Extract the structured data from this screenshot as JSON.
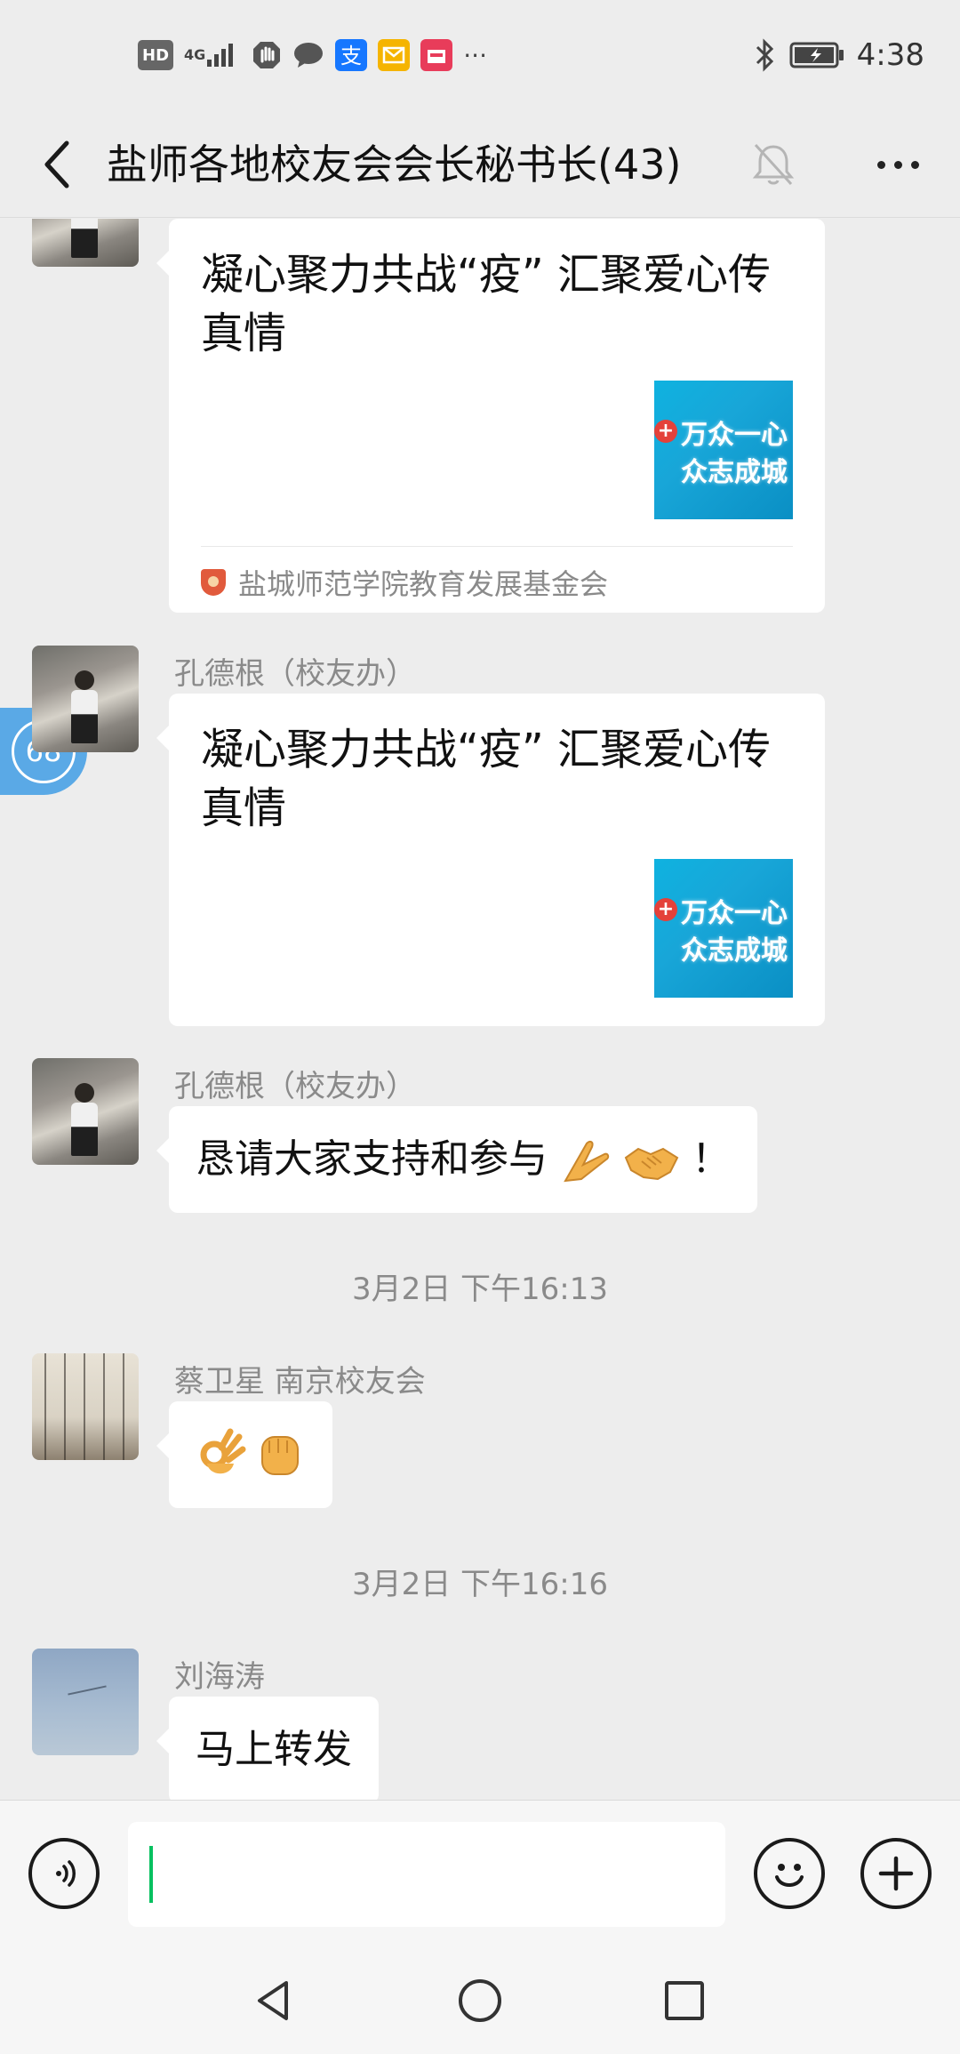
{
  "status_bar": {
    "hd": "HD",
    "network": "4G",
    "time": "4:38",
    "more": "···"
  },
  "header": {
    "title": "盐师各地校友会会长秘书长(43)"
  },
  "unread_badge": "68",
  "messages": [
    {
      "type": "link",
      "title": "凝心聚力共战“疫” 汇聚爱心传真情",
      "thumb_line1": "万众一心",
      "thumb_line2": "众志成城",
      "source": "盐城师范学院教育发展基金会"
    },
    {
      "type": "link",
      "sender": "孔德根（校友办）",
      "title": "凝心聚力共战“疫” 汇聚爱心传真情",
      "thumb_line1": "万众一心",
      "thumb_line2": "众志成城"
    },
    {
      "type": "text",
      "sender": "孔德根（校友办）",
      "text": "恳请大家支持和参与",
      "suffix": "！"
    },
    {
      "type": "time",
      "text": "3月2日 下午16:13"
    },
    {
      "type": "emoji",
      "sender": "蔡卫星 南京校友会"
    },
    {
      "type": "time",
      "text": "3月2日 下午16:16"
    },
    {
      "type": "text",
      "sender": "刘海涛",
      "text": "马上转发"
    }
  ],
  "input": {
    "value": ""
  },
  "colors": {
    "background": "#ededed",
    "bubble": "#ffffff",
    "accent": "#07c160",
    "badge": "#5aa9e6"
  }
}
